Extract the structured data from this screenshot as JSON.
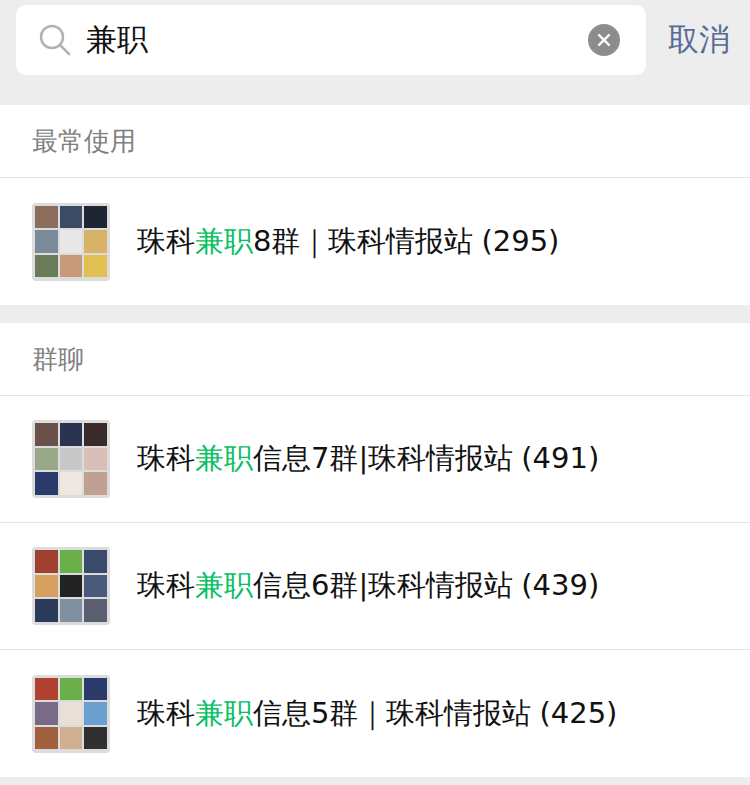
{
  "search": {
    "query": "兼职",
    "cancel": "取消"
  },
  "sections": [
    {
      "title": "最常使用",
      "items": [
        {
          "before": "珠科",
          "highlight": "兼职",
          "after": "8群｜珠科情报站",
          "count": "(295)"
        }
      ]
    },
    {
      "title": "群聊",
      "items": [
        {
          "before": "珠科",
          "highlight": "兼职",
          "after": "信息7群|珠科情报站",
          "count": "(491)"
        },
        {
          "before": "珠科",
          "highlight": "兼职",
          "after": "信息6群|珠科情报站",
          "count": "(439)"
        },
        {
          "before": "珠科",
          "highlight": "兼职",
          "after": "信息5群｜珠科情报站",
          "count": "(425)"
        }
      ]
    }
  ]
}
